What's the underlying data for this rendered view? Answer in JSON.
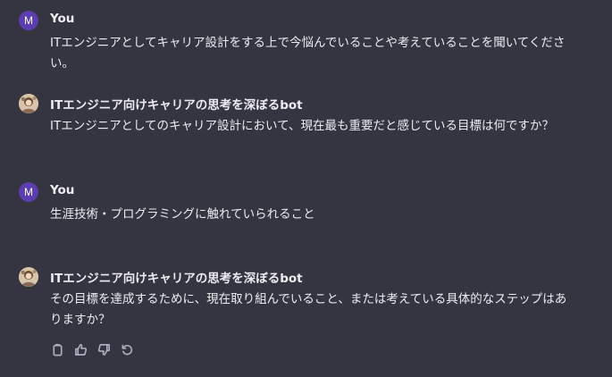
{
  "messages": [
    {
      "role": "user",
      "avatar_letter": "M",
      "author": "You",
      "text": "ITエンジニアとしてキャリア設計をする上で今悩んでいることや考えていることを聞いてください。"
    },
    {
      "role": "bot",
      "author": "ITエンジニア向けキャリアの思考を深ぼるbot",
      "text": "ITエンジニアとしてのキャリア設計において、現在最も重要だと感じている目標は何ですか？"
    },
    {
      "role": "user",
      "avatar_letter": "M",
      "author": "You",
      "text": "生涯技術・プログラミングに触れていられること"
    },
    {
      "role": "bot",
      "author": "ITエンジニア向けキャリアの思考を深ぼるbot",
      "text": "その目標を達成するために、現在取り組んでいること、または考えている具体的なステップはありますか？"
    }
  ],
  "actions": {
    "icons": [
      "copy-icon",
      "thumbs-up-icon",
      "thumbs-down-icon",
      "regenerate-icon"
    ]
  },
  "colors": {
    "background": "#343541",
    "text": "#ececf1",
    "user_avatar": "#5b3fb1",
    "icon": "#acacbe"
  }
}
